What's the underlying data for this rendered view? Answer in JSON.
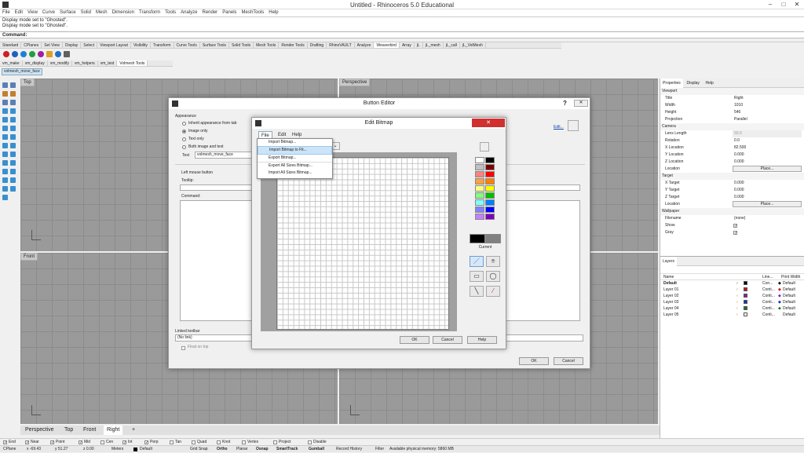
{
  "window": {
    "title": "Untitled - Rhinoceros 5.0 Educational",
    "min": "–",
    "max": "□",
    "close": "✕"
  },
  "menus": [
    "File",
    "Edit",
    "View",
    "Curve",
    "Surface",
    "Solid",
    "Mesh",
    "Dimension",
    "Transform",
    "Tools",
    "Analyze",
    "Render",
    "Panels",
    "MeshTools",
    "Help"
  ],
  "history": [
    "Display mode set to \"Ghosted\".",
    "Display mode set to \"Ghosted\"."
  ],
  "command_label": "Command:",
  "toolbar_tabs": [
    "Standard",
    "CPlanes",
    "Set View",
    "Display",
    "Select",
    "Viewport Layout",
    "Visibility",
    "Transform",
    "Curve Tools",
    "Surface Tools",
    "Solid Tools",
    "Mesh Tools",
    "Render Tools",
    "Drafting",
    "RhinoVAULT",
    "Analyze",
    "Weaverbird",
    "Array",
    "jL",
    "jL_mesh",
    "jL_call",
    "jL_VolMesh"
  ],
  "toolbar_tabs_active": "Weaverbird",
  "sub_tabs": [
    "vm_make",
    "vm_display",
    "vm_modify",
    "vm_helpers",
    "vm_test",
    "Volmesh Tools"
  ],
  "sub_tabs_active": "Volmesh Tools",
  "user_button": "volmesh_move_face",
  "viewports": {
    "top": "Top",
    "perspective": "Perspective",
    "front": "Front",
    "right": "Right"
  },
  "viewport_tabs": [
    "Perspective",
    "Top",
    "Front",
    "Right",
    "+"
  ],
  "viewport_tabs_active": "Right",
  "button_editor": {
    "title": "Button Editor",
    "help": "?",
    "appearance": "Appearance",
    "radio": [
      "Inherit appearance from tab",
      "Image only",
      "Text only",
      "Both image and text"
    ],
    "radio_selected": "Image only",
    "text_label": "Text",
    "text_value": "volmesh_move_face",
    "edit_link": "Edit...",
    "left_mouse": "Left mouse button",
    "tooltip_label": "Tooltip:",
    "command_label": "Command:",
    "linked_label": "Linked toolbar",
    "linked_value": "(No link)",
    "float_label": "Float on top",
    "ok": "OK",
    "cancel": "Cancel"
  },
  "edit_bitmap": {
    "title": "Edit Bitmap",
    "menu": [
      "File",
      "Edit",
      "Help"
    ],
    "file_items": [
      "Import Bitmap...",
      "Import Bitmap to Fit...",
      "Export Bitmap...",
      "Export All Sizes Bitmap...",
      "Import All Sizes Bitmap..."
    ],
    "file_item_highlight": "Import Bitmap to Fit...",
    "current_label": "Current",
    "palette": [
      "#ffffff",
      "#000000",
      "#c0c0c0",
      "#800000",
      "#ff8080",
      "#ff0000",
      "#ffa040",
      "#ff8000",
      "#ffff80",
      "#ffff00",
      "#80ff80",
      "#00c000",
      "#80ffff",
      "#0080ff",
      "#8080ff",
      "#0000ff",
      "#c080ff",
      "#8000c0"
    ],
    "current_fg": "#000000",
    "current_bg": "#808080",
    "tools": [
      "pencil-icon",
      "fill-icon",
      "rectangle-icon",
      "ellipse-icon",
      "line-icon",
      "eyedropper-icon"
    ],
    "ok": "OK",
    "cancel": "Cancel",
    "help": "Help"
  },
  "right_panel": {
    "tabs": [
      "Properties",
      "Display",
      "Help"
    ],
    "viewport_section": "Viewport",
    "viewport_props": [
      [
        "Title",
        "Right"
      ],
      [
        "Width",
        "1010"
      ],
      [
        "Height",
        "546"
      ],
      [
        "Projection",
        "Parallel"
      ]
    ],
    "camera_section": "Camera",
    "camera_props": [
      [
        "Lens Length",
        "50.0"
      ],
      [
        "Rotation",
        "0.0"
      ],
      [
        "X Location",
        "82.500"
      ],
      [
        "Y Location",
        "0.000"
      ],
      [
        "Z Location",
        "0.000"
      ]
    ],
    "camera_location": "Location",
    "place_btn": "Place...",
    "target_section": "Target",
    "target_props": [
      [
        "X Target",
        "0.000"
      ],
      [
        "Y Target",
        "0.000"
      ],
      [
        "Z Target",
        "0.000"
      ]
    ],
    "target_location": "Location",
    "wallpaper_section": "Wallpaper",
    "wallpaper_props": [
      [
        "Filename",
        "(none)"
      ],
      [
        "Show",
        ""
      ],
      [
        "Gray",
        ""
      ]
    ],
    "layers_tab": "Layers",
    "layer_headers": [
      "Name",
      "Line...",
      "Print Width"
    ],
    "layers": [
      {
        "name": "Default",
        "line": "Con...",
        "print": "Default",
        "color": "#000000"
      },
      {
        "name": "Layer 01",
        "line": "Conti...",
        "print": "Default",
        "color": "#d01010"
      },
      {
        "name": "Layer 02",
        "line": "Conti...",
        "print": "Default",
        "color": "#8020c0"
      },
      {
        "name": "Layer 03",
        "line": "Conti...",
        "print": "Default",
        "color": "#1030d0"
      },
      {
        "name": "Layer 04",
        "line": "Conti...",
        "print": "Default",
        "color": "#108010"
      },
      {
        "name": "Layer 05",
        "line": "Conti...",
        "print": "Default",
        "color": "#ffffff"
      }
    ]
  },
  "osnaps": [
    "End",
    "Near",
    "Point",
    "Mid",
    "Cen",
    "Int",
    "Perp",
    "Tan",
    "Quad",
    "Knot",
    "Vertex",
    "Project",
    "Disable"
  ],
  "osnaps_checked": [
    "End",
    "Near",
    "Point",
    "Mid",
    "Int",
    "Perp"
  ],
  "status": {
    "cplane": "CPlane",
    "x": "x -69.43",
    "y": "y 51.27",
    "z": "z 0.00",
    "units": "Meters",
    "layer": "Default",
    "grid": "Grid Snap",
    "ortho": "Ortho",
    "planar": "Planar",
    "osnap": "Osnap",
    "smarttrack": "SmartTrack",
    "gumball": "Gumball",
    "history": "Record History",
    "filter": "Filter",
    "memory": "Available physical memory: 5860 MB"
  }
}
